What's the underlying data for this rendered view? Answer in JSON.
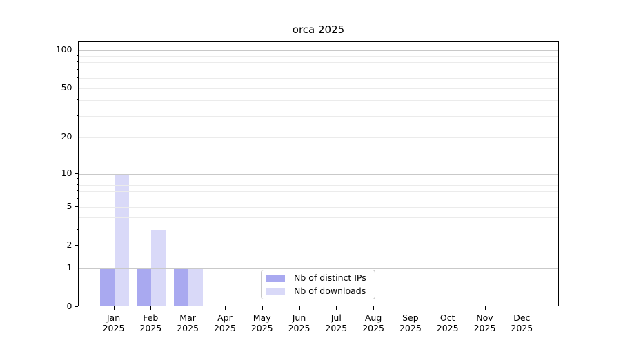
{
  "chart_data": {
    "type": "bar",
    "title": "orca 2025",
    "year": "2025",
    "months": [
      "Jan",
      "Feb",
      "Mar",
      "Apr",
      "May",
      "Jun",
      "Jul",
      "Aug",
      "Sep",
      "Oct",
      "Nov",
      "Dec"
    ],
    "series": [
      {
        "name": "Nb of distinct IPs",
        "color": "#a9a9f0",
        "values": [
          1,
          1,
          1,
          0,
          0,
          0,
          0,
          0,
          0,
          0,
          0,
          0
        ]
      },
      {
        "name": "Nb of downloads",
        "color": "#d9d9f8",
        "values": [
          10,
          3,
          1,
          0,
          0,
          0,
          0,
          0,
          0,
          0,
          0,
          0
        ]
      }
    ],
    "y_axis": {
      "scale": "log10(1+value)",
      "tick_labels": [
        "0",
        "1",
        "2",
        "5",
        "10",
        "20",
        "50",
        "100"
      ],
      "tick_values": [
        0,
        1,
        2,
        5,
        10,
        20,
        50,
        100
      ],
      "major_gridlines": [
        1,
        10,
        100
      ],
      "minor_gridlines": [
        2,
        3,
        4,
        5,
        6,
        7,
        8,
        9,
        20,
        30,
        40,
        50,
        60,
        70,
        80,
        90
      ],
      "ylim_top": 115
    },
    "legend_position": "lower center",
    "colors": {
      "grid_major": "#c9c9c9",
      "grid_minor": "#ebebeb",
      "spine": "#000000",
      "background": "#ffffff"
    }
  }
}
